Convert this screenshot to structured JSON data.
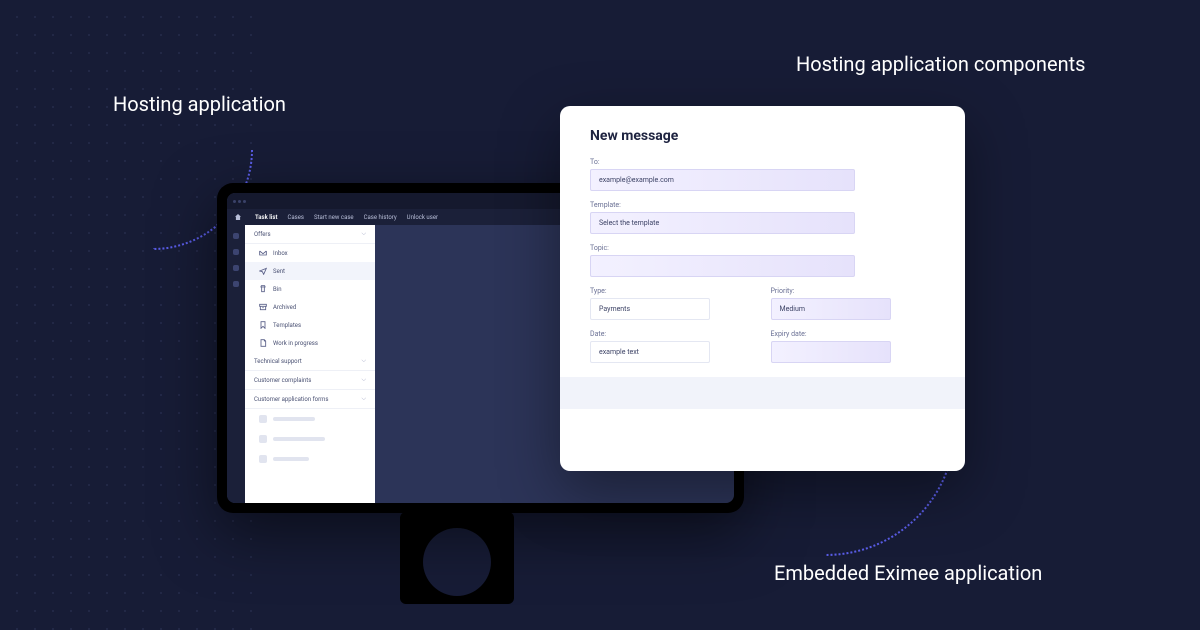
{
  "annotations": {
    "hosting": "Hosting application",
    "components": "Hosting application components",
    "embedded": "Embedded Eximee application"
  },
  "menubar": {
    "items": [
      "Task list",
      "Cases",
      "Start new case",
      "Case history",
      "Unlock user"
    ]
  },
  "sidebar": {
    "sections": {
      "offers": "Offers",
      "tech": "Technical support",
      "complaints": "Customer complaints",
      "forms": "Customer application forms"
    },
    "items": {
      "inbox": "Inbox",
      "sent": "Sent",
      "bin": "Bin",
      "archived": "Archived",
      "templates": "Templates",
      "wip": "Work in progress"
    }
  },
  "panel": {
    "title": "New message",
    "labels": {
      "to": "To:",
      "template": "Template:",
      "topic": "Topic:",
      "type": "Type:",
      "priority": "Priority:",
      "date": "Date:",
      "expiry": "Expiry date:"
    },
    "values": {
      "to": "example@example.com",
      "template": "Select the template",
      "topic": "",
      "type": "Payments",
      "priority": "Medium",
      "date": "example text",
      "expiry": ""
    }
  }
}
